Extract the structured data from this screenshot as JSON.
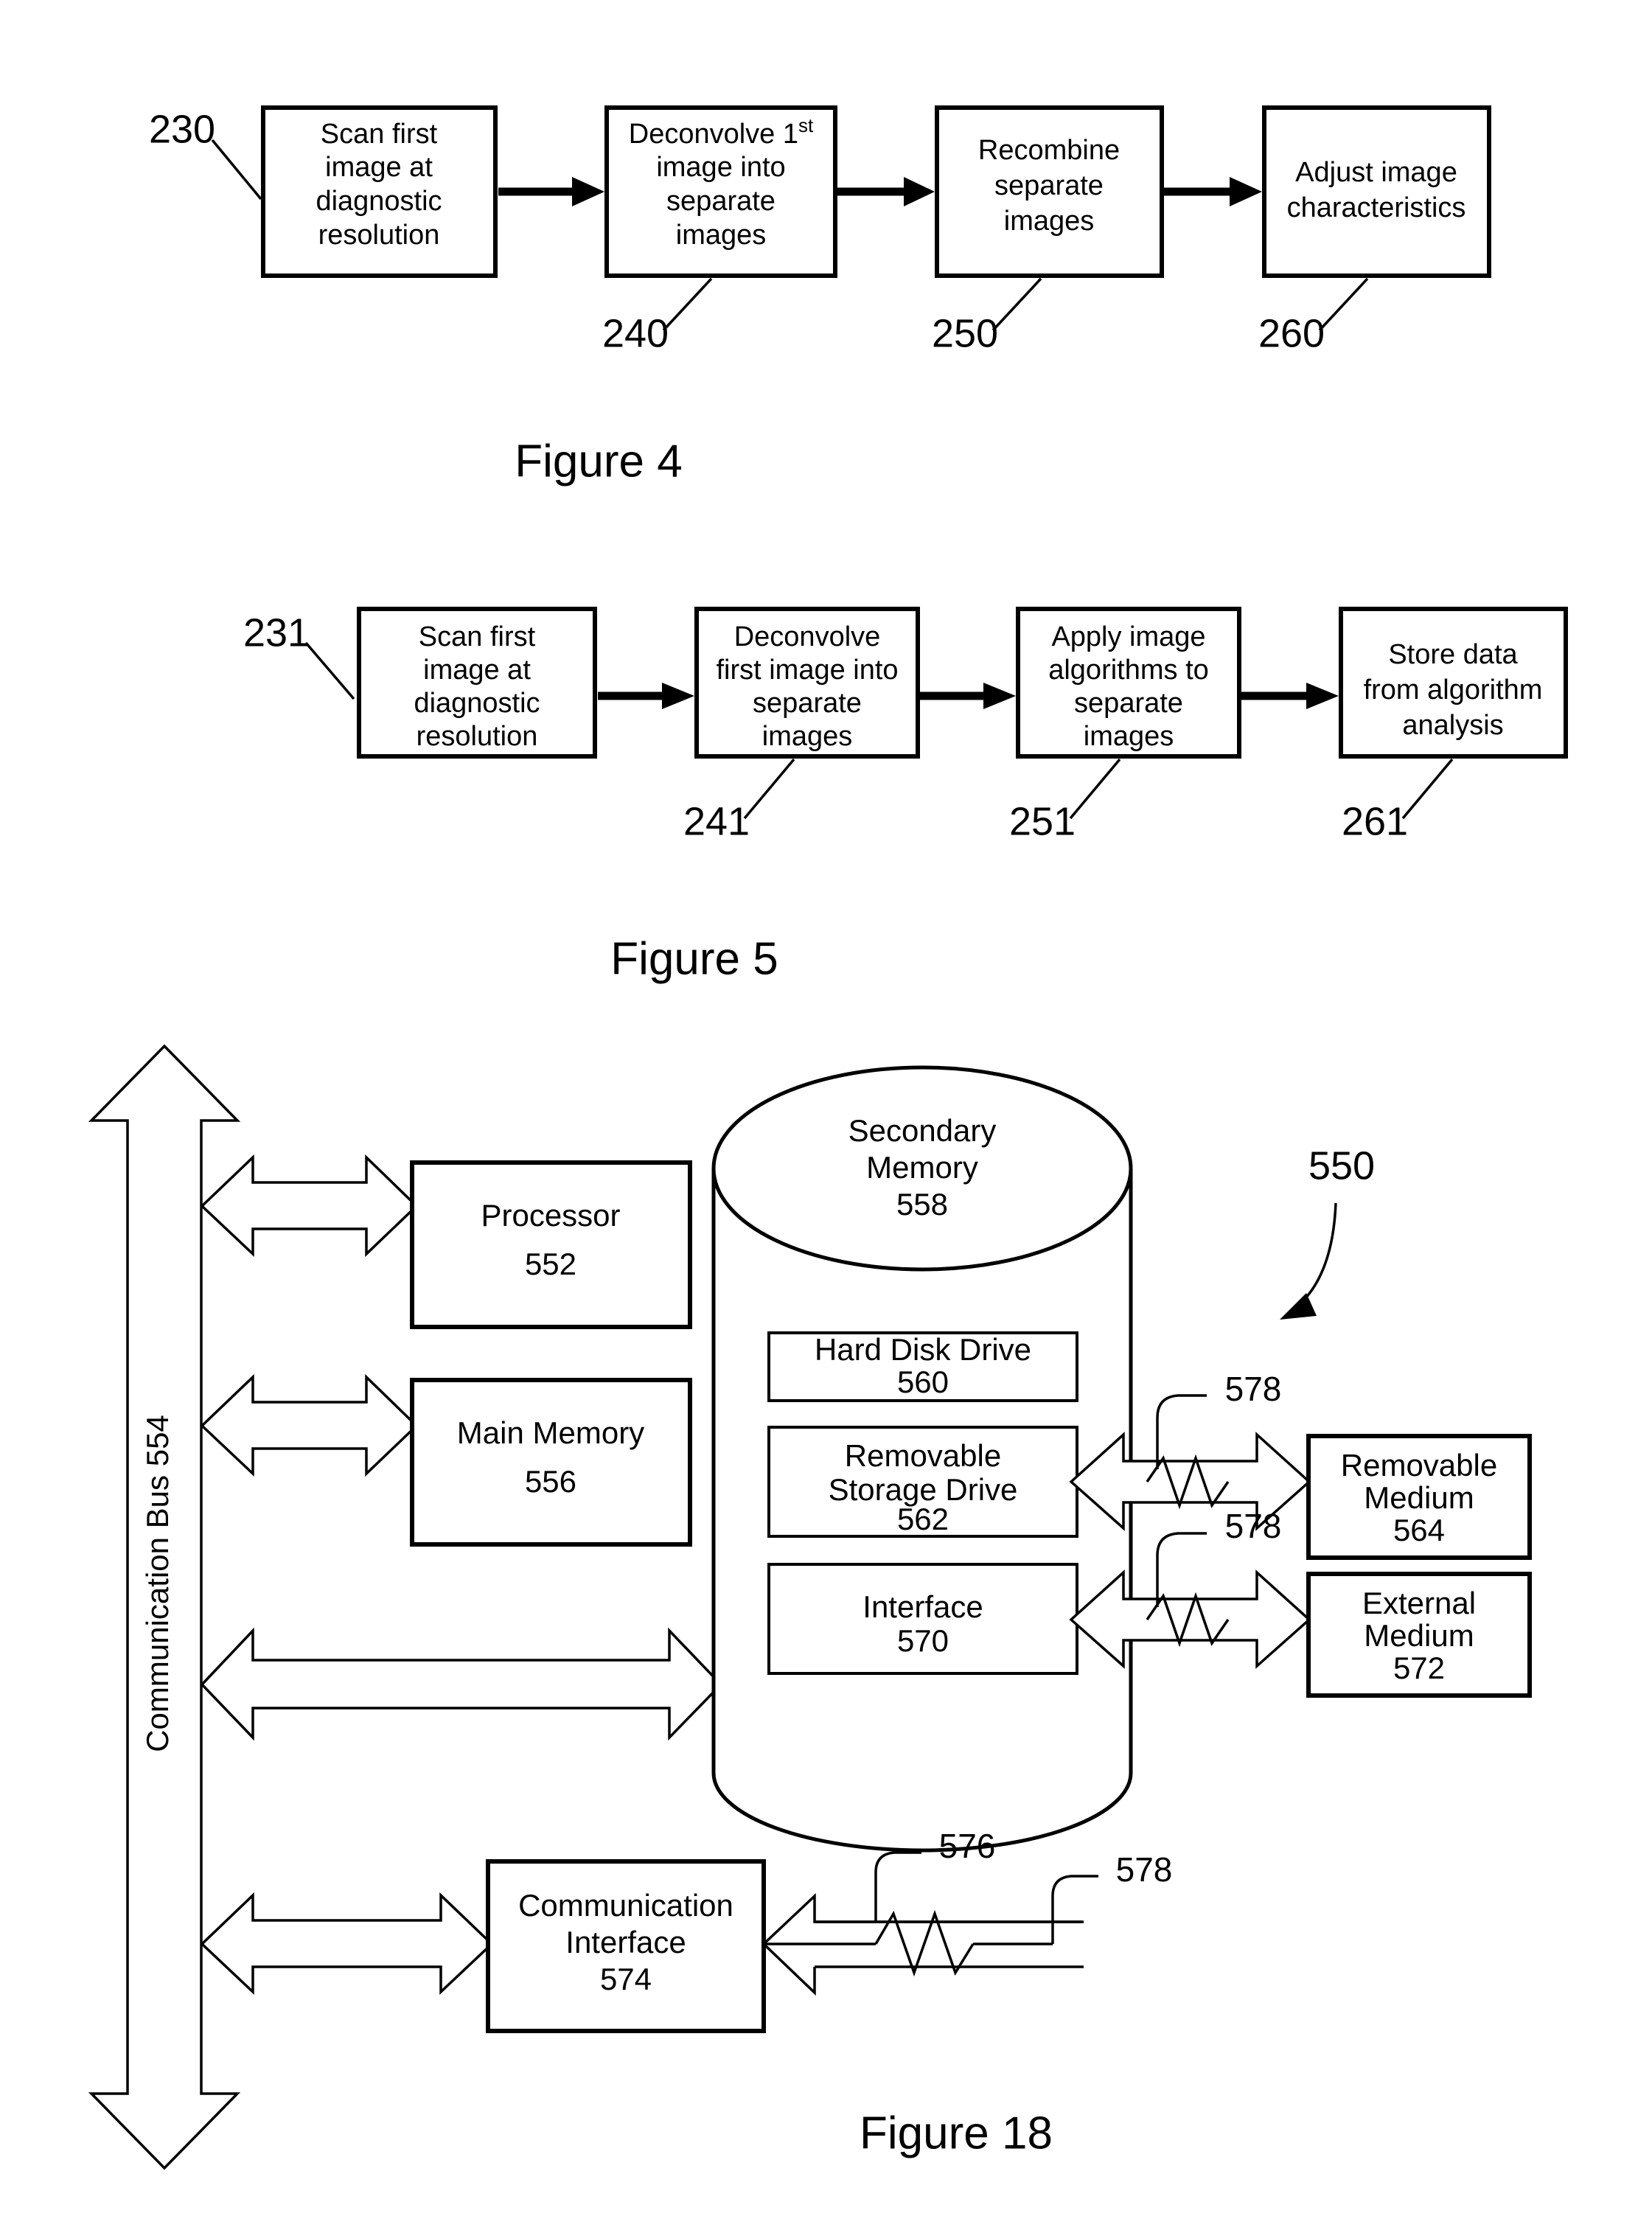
{
  "document": {
    "type": "patent-figure-sheet",
    "figures": [
      "Figure 4",
      "Figure 5",
      "Figure 18"
    ]
  },
  "figure4": {
    "caption": "Figure 4",
    "entry_ref": "230",
    "boxes": [
      {
        "id": "fig4-box-230",
        "lines": [
          "Scan first",
          "image at",
          "diagnostic",
          "resolution"
        ],
        "ref": "230"
      },
      {
        "id": "fig4-box-240",
        "lines": [
          "Deconvolve 1st",
          "image into",
          "separate",
          "images"
        ],
        "base": "Deconvolve 1",
        "superscript": "st",
        "ref": "240"
      },
      {
        "id": "fig4-box-250",
        "lines": [
          "Recombine",
          "separate",
          "images"
        ],
        "ref": "250"
      },
      {
        "id": "fig4-box-260",
        "lines": [
          "Adjust image",
          "characteristics"
        ],
        "ref": "260"
      }
    ],
    "refs_below": [
      "240",
      "250",
      "260"
    ]
  },
  "figure5": {
    "caption": "Figure 5",
    "entry_ref": "231",
    "boxes": [
      {
        "id": "fig5-box-231",
        "lines": [
          "Scan first",
          "image at",
          "diagnostic",
          "resolution"
        ],
        "ref": "231"
      },
      {
        "id": "fig5-box-241",
        "lines": [
          "Deconvolve",
          "first image into",
          "separate",
          "images"
        ],
        "ref": "241"
      },
      {
        "id": "fig5-box-251",
        "lines": [
          "Apply image",
          "algorithms to",
          "separate",
          "images"
        ],
        "ref": "251"
      },
      {
        "id": "fig5-box-261",
        "lines": [
          "Store data",
          "from algorithm",
          "analysis"
        ],
        "ref": "261"
      }
    ],
    "refs_below": [
      "241",
      "251",
      "261"
    ]
  },
  "figure18": {
    "caption": "Figure 18",
    "system_ref": "550",
    "bus": {
      "label": "Communication Bus 554"
    },
    "processor": {
      "name": "Processor",
      "ref": "552"
    },
    "main_memory": {
      "name": "Main Memory",
      "ref": "556"
    },
    "secondary_memory": {
      "name_line1": "Secondary",
      "name_line2": "Memory",
      "ref": "558"
    },
    "hard_disk_drive": {
      "name": "Hard Disk Drive",
      "ref": "560"
    },
    "removable_storage_drive": {
      "name_line1": "Removable",
      "name_line2": "Storage Drive",
      "ref": "562"
    },
    "interface": {
      "name": "Interface",
      "ref": "570"
    },
    "removable_medium": {
      "name_line1": "Removable",
      "name_line2": "Medium",
      "ref": "564"
    },
    "external_medium": {
      "name_line1": "External",
      "name_line2": "Medium",
      "ref": "572"
    },
    "communication_interface": {
      "name_line1": "Communication",
      "name_line2": "Interface",
      "ref": "574"
    },
    "link_refs": {
      "removable_link": "578",
      "external_link": "578",
      "comm_channel": "576",
      "comm_link": "578"
    }
  }
}
